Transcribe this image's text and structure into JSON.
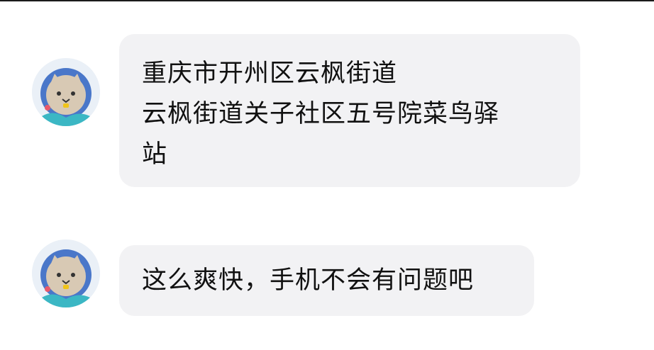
{
  "messages": [
    {
      "lines": [
        "重庆市开州区云枫街道",
        "云枫街道关子社区五号院菜鸟驿",
        "站"
      ]
    },
    {
      "lines": [
        "这么爽快，手机不会有问题吧"
      ]
    }
  ],
  "avatar": {
    "icon": "cat-astronaut-avatar-icon"
  },
  "colors": {
    "bubble": "#f2f2f4",
    "text": "#111111",
    "avatar_helmet": "#4a77c9",
    "avatar_face": "#d8c9b4"
  }
}
